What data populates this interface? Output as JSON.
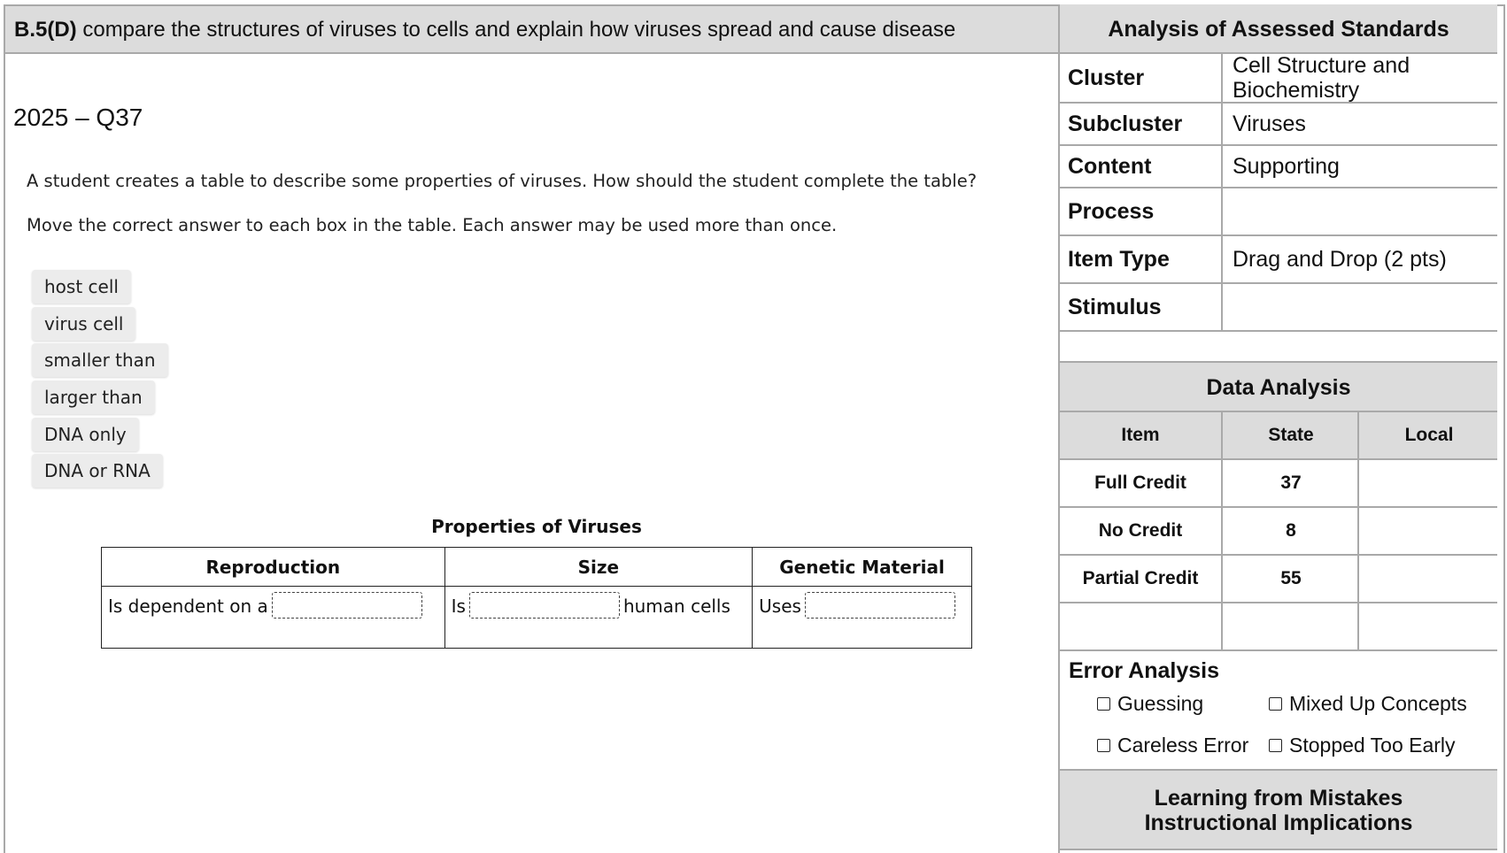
{
  "standard": {
    "code": "B.5(D)",
    "text": "compare the structures of viruses to cells and explain how viruses spread and cause disease"
  },
  "question": {
    "id": "2025 – Q37",
    "prompt1": "A student creates a table to describe some properties of viruses. How should the student complete the table?",
    "prompt2": "Move the correct answer to each box in the table. Each answer may be used more than once.",
    "choices": [
      "host cell",
      "virus cell",
      "smaller than",
      "larger than",
      "DNA only",
      "DNA or RNA"
    ],
    "table": {
      "title": "Properties of Viruses",
      "headers": [
        "Reproduction",
        "Size",
        "Genetic Material"
      ],
      "row": {
        "reproduction_pre": "Is dependent on a",
        "size_pre": "Is",
        "size_post": "human cells",
        "genetic_pre": "Uses"
      }
    }
  },
  "analysis": {
    "title": "Analysis of Assessed Standards",
    "rows": [
      {
        "label": "Cluster",
        "value": "Cell Structure and Biochemistry"
      },
      {
        "label": "Subcluster",
        "value": "Viruses"
      },
      {
        "label": "Content",
        "value": "Supporting"
      },
      {
        "label": "Process",
        "value": ""
      },
      {
        "label": "Item Type",
        "value": "Drag and Drop (2 pts)"
      },
      {
        "label": "Stimulus",
        "value": ""
      }
    ]
  },
  "data_analysis": {
    "title": "Data Analysis",
    "headers": [
      "Item",
      "State",
      "Local"
    ],
    "rows": [
      {
        "item": "Full Credit",
        "state": "37",
        "local": ""
      },
      {
        "item": "No Credit",
        "state": "8",
        "local": ""
      },
      {
        "item": "Partial Credit",
        "state": "55",
        "local": ""
      }
    ]
  },
  "error_analysis": {
    "title": "Error Analysis",
    "options": [
      "Guessing",
      "Mixed Up Concepts",
      "Careless Error",
      "Stopped Too Early"
    ]
  },
  "learning": {
    "line1": "Learning from Mistakes",
    "line2": "Instructional Implications"
  }
}
